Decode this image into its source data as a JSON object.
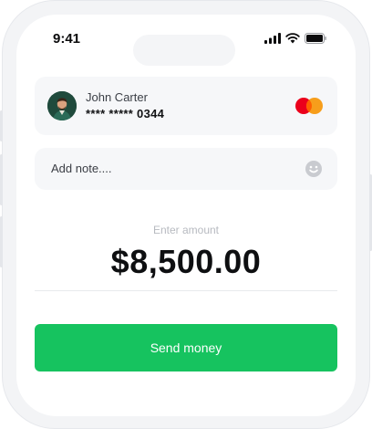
{
  "status_bar": {
    "time": "9:41"
  },
  "recipient": {
    "name": "John Carter",
    "card_number": "**** ***** 0344"
  },
  "note": {
    "placeholder": "Add note...."
  },
  "amount": {
    "label": "Enter amount",
    "value": "$8,500.00"
  },
  "actions": {
    "send_label": "Send money"
  },
  "colors": {
    "accent": "#16c35f",
    "mastercard_red": "#eb001b",
    "mastercard_orange": "#f79e1b"
  },
  "icons": [
    "signal-icon",
    "wifi-icon",
    "battery-icon",
    "mastercard-logo",
    "smile-icon"
  ]
}
